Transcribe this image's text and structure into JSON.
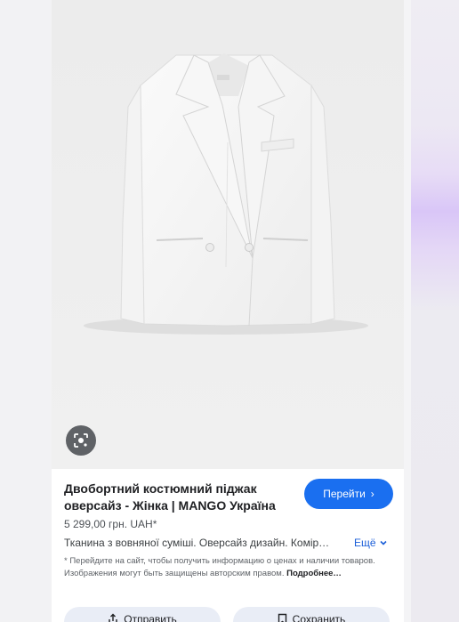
{
  "product": {
    "title": "Двобортний костюмний піджак оверсайз - Жінка | MANGO Україна",
    "price": "5 299,00 грн. UAH*",
    "description": "Тканина з вовняної суміші. Оверсайз дизайн. Комір…",
    "more_label": "Ещё",
    "note_text": "* Перейдите на сайт, чтобы получить информацию о ценах и наличии товаров. Изображения могут быть защищены авторским правом. ",
    "note_link": "Подробнее…"
  },
  "buttons": {
    "visit": "Перейти",
    "send": "Отправить",
    "save": "Сохранить"
  },
  "icons": {
    "lens": "google-lens-icon",
    "visit_chevron": "chevron-right-icon",
    "more_chevron": "chevron-down-icon",
    "share": "share-icon",
    "bookmark": "bookmark-icon"
  },
  "colors": {
    "accent": "#1a6ff0",
    "link": "#1a5ed8",
    "action_bg": "#e9edf6"
  }
}
